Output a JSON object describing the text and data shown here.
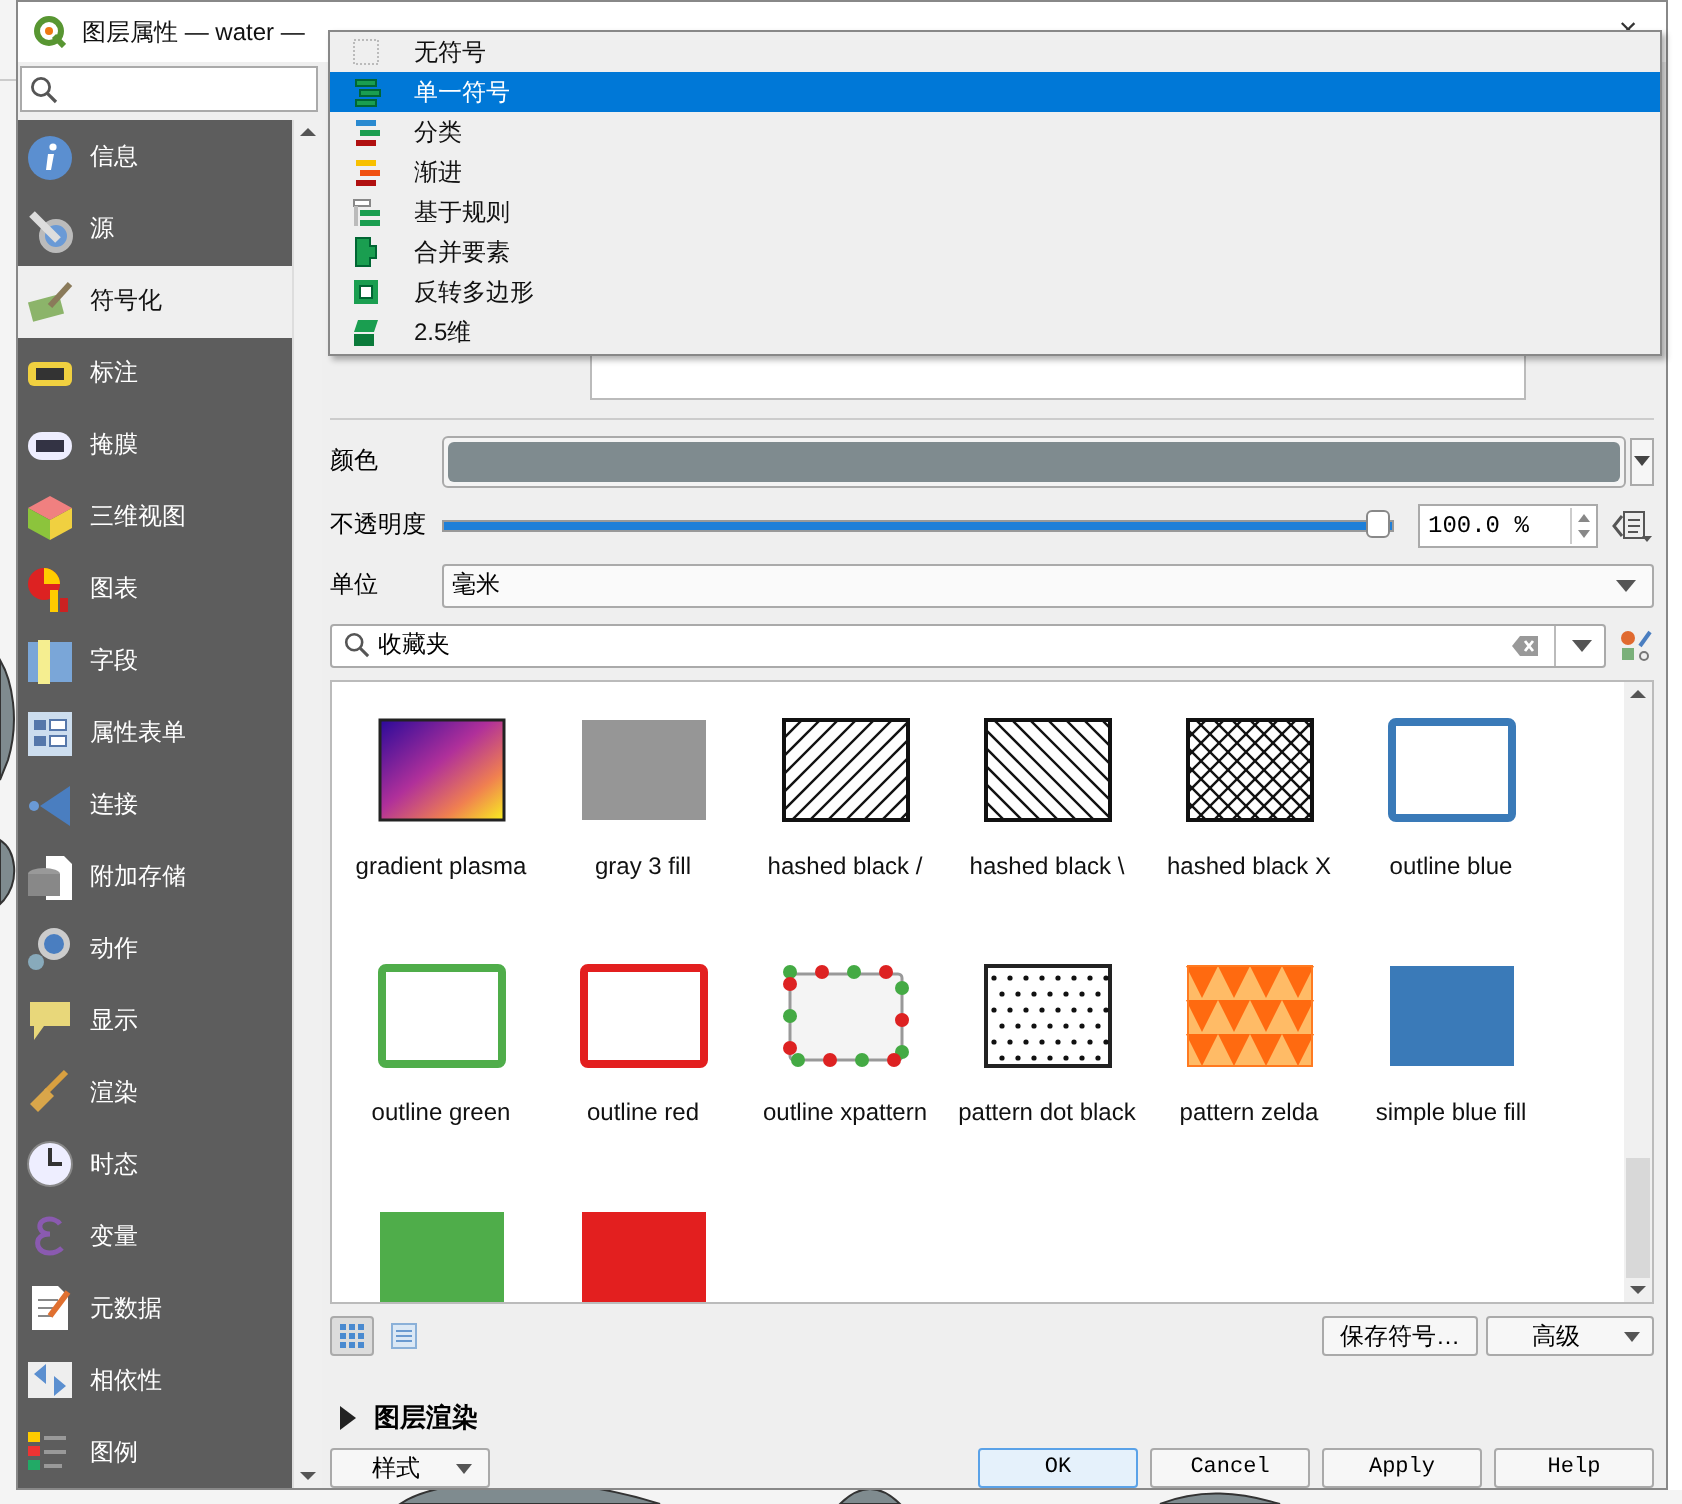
{
  "window": {
    "title": "图层属性 — water —",
    "close": "×"
  },
  "sidebar": {
    "items": [
      {
        "label": "信息",
        "selected": false
      },
      {
        "label": "源",
        "selected": false
      },
      {
        "label": "符号化",
        "selected": true
      },
      {
        "label": "标注",
        "selected": false
      },
      {
        "label": "掩膜",
        "selected": false
      },
      {
        "label": "三维视图",
        "selected": false
      },
      {
        "label": "图表",
        "selected": false
      },
      {
        "label": "字段",
        "selected": false
      },
      {
        "label": "属性表单",
        "selected": false
      },
      {
        "label": "连接",
        "selected": false
      },
      {
        "label": "附加存储",
        "selected": false
      },
      {
        "label": "动作",
        "selected": false
      },
      {
        "label": "显示",
        "selected": false
      },
      {
        "label": "渲染",
        "selected": false
      },
      {
        "label": "时态",
        "selected": false
      },
      {
        "label": "变量",
        "selected": false
      },
      {
        "label": "元数据",
        "selected": false
      },
      {
        "label": "相依性",
        "selected": false
      },
      {
        "label": "图例",
        "selected": false
      }
    ]
  },
  "renderer_menu": [
    {
      "label": "无符号",
      "kind": "none",
      "selected": false
    },
    {
      "label": "单一符号",
      "kind": "single",
      "selected": true
    },
    {
      "label": "分类",
      "kind": "categorized",
      "selected": false
    },
    {
      "label": "渐进",
      "kind": "graduated",
      "selected": false
    },
    {
      "label": "基于规则",
      "kind": "rule",
      "selected": false
    },
    {
      "label": "合并要素",
      "kind": "merged",
      "selected": false
    },
    {
      "label": "反转多边形",
      "kind": "inverted",
      "selected": false
    },
    {
      "label": "2.5维",
      "kind": "extruded",
      "selected": false
    }
  ],
  "color": {
    "label": "颜色",
    "color": "#7f8b8f"
  },
  "opacity": {
    "label": "不透明度",
    "level": 1,
    "value": "100.0 %"
  },
  "unit": {
    "label": "单位",
    "value": "毫米"
  },
  "library_search": {
    "value": "收藏夹"
  },
  "symbols": [
    {
      "name": "gradient plasma",
      "kind": "gradient"
    },
    {
      "name": "gray 3 fill",
      "kind": "fill",
      "color": "#969696"
    },
    {
      "name": "hashed black /",
      "kind": "hash-forward"
    },
    {
      "name": "hashed black \\",
      "kind": "hash-back"
    },
    {
      "name": "hashed black X",
      "kind": "hash-cross"
    },
    {
      "name": "outline blue",
      "kind": "outline",
      "color": "#3a7ab8"
    },
    {
      "name": "outline green",
      "kind": "outline",
      "color": "#4fad4a"
    },
    {
      "name": "outline red",
      "kind": "outline",
      "color": "#e31f1f"
    },
    {
      "name": "outline xpattern",
      "kind": "xpattern"
    },
    {
      "name": "pattern dot black",
      "kind": "dots"
    },
    {
      "name": "pattern zelda",
      "kind": "zelda"
    },
    {
      "name": "simple blue fill",
      "kind": "fill",
      "color": "#3a7ab8"
    },
    {
      "kind": "fill",
      "color": "#4fad4a"
    },
    {
      "kind": "fill",
      "color": "#e31f1f"
    }
  ],
  "view_modes": [
    {
      "kind": "icons",
      "selected": true
    },
    {
      "kind": "list",
      "selected": false
    }
  ],
  "save_symbol": "保存符号…",
  "advanced": "高级",
  "layer_rendering": {
    "label": "图层渲染",
    "expanded": false
  },
  "style_menu": "样式",
  "buttons": [
    "OK",
    "Cancel",
    "Apply",
    "Help"
  ]
}
